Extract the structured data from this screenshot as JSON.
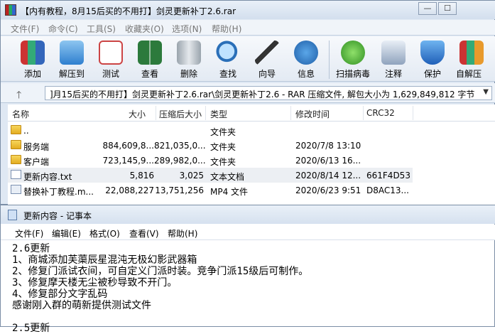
{
  "winrar": {
    "title": "【内有教程，8月15后买的不用打】剑灵更新补丁2.6.rar",
    "buttons": {
      "minimize": "—",
      "maximize": "☐"
    },
    "menu": [
      "文件(F)",
      "命令(C)",
      "工具(S)",
      "收藏夹(O)",
      "选项(N)",
      "帮助(H)"
    ],
    "toolbar": [
      {
        "label": "添加",
        "icon": "add-books-icon"
      },
      {
        "label": "解压到",
        "icon": "extract-folder-icon"
      },
      {
        "label": "测试",
        "icon": "test-clipboard-icon"
      },
      {
        "label": "查看",
        "icon": "view-book-icon"
      },
      {
        "label": "删除",
        "icon": "trash-icon"
      },
      {
        "label": "查找",
        "icon": "magnifier-icon"
      },
      {
        "label": "向导",
        "icon": "wizard-wand-icon"
      },
      {
        "label": "信息",
        "icon": "info-icon"
      },
      {
        "label": "扫描病毒",
        "icon": "virus-scan-icon"
      },
      {
        "label": "注释",
        "icon": "comment-icon"
      },
      {
        "label": "保护",
        "icon": "shield-icon"
      },
      {
        "label": "自解压",
        "icon": "sfx-icon"
      }
    ],
    "path": "]月15后买的不用打】剑灵更新补丁2.6.rar\\剑灵更新补丁2.6 - RAR 压缩文件, 解包大小为 1,629,849,812 字节",
    "columns": [
      "名称",
      "大小",
      "压缩后大小",
      "类型",
      "修改时间",
      "CRC32"
    ],
    "files": [
      {
        "name": "..",
        "size": "",
        "packed": "",
        "type": "文件夹",
        "modified": "",
        "crc": "",
        "kind": "folder"
      },
      {
        "name": "服务端",
        "size": "884,609,8...",
        "packed": "821,035,0...",
        "type": "文件夹",
        "modified": "2020/7/8 13:10",
        "crc": "",
        "kind": "folder"
      },
      {
        "name": "客户端",
        "size": "723,145,9...",
        "packed": "289,982,0...",
        "type": "文件夹",
        "modified": "2020/6/13 16...",
        "crc": "",
        "kind": "folder"
      },
      {
        "name": "更新内容.txt",
        "size": "5,816",
        "packed": "3,025",
        "type": "文本文档",
        "modified": "2020/8/14 12...",
        "crc": "661F4D53",
        "kind": "txt"
      },
      {
        "name": "替换补丁教程.m...",
        "size": "22,088,227",
        "packed": "13,751,256",
        "type": "MP4 文件",
        "modified": "2020/6/23 9:51",
        "crc": "D8AC13...",
        "kind": "mp4"
      }
    ]
  },
  "notepad": {
    "title": "更新内容 - 记事本",
    "menu": [
      "文件(F)",
      "编辑(E)",
      "格式(O)",
      "查看(V)",
      "帮助(H)"
    ],
    "lines": [
      "2.6更新",
      "1、商城添加芙蕖辰星混沌无极幻影武器箱",
      "2、修复门派试衣间，可自定义门派时装。竞争门派15级后可制作。",
      "3、修复摩天楼无尘被秒导致不开门。",
      "4、修复部分文字乱码",
      "感谢刚入群的萌新提供测试文件",
      "",
      "2.5更新"
    ]
  }
}
